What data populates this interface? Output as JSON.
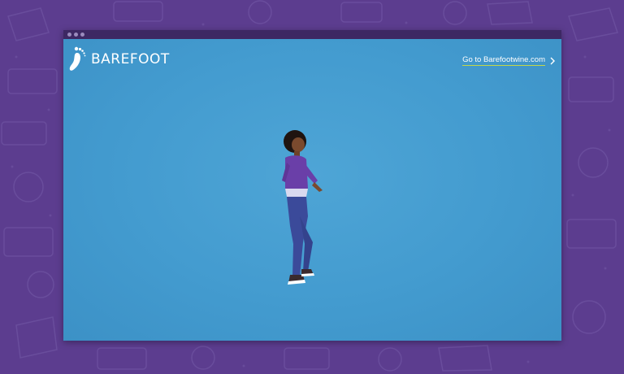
{
  "background": {
    "color": "#5c3d8f",
    "pattern_color": "#6b4f9e"
  },
  "window": {
    "titlebar_color": "#3d2863",
    "viewport_color": "#439bcf"
  },
  "header": {
    "logo_text": "BAREFOOT",
    "logo_icon": "footprint-icon",
    "link_text": "Go to Barefootwine.com",
    "link_icon": "chevron-right-icon",
    "link_underline_color": "#c2d64a"
  },
  "hero": {
    "subject": "dancer-figure"
  }
}
